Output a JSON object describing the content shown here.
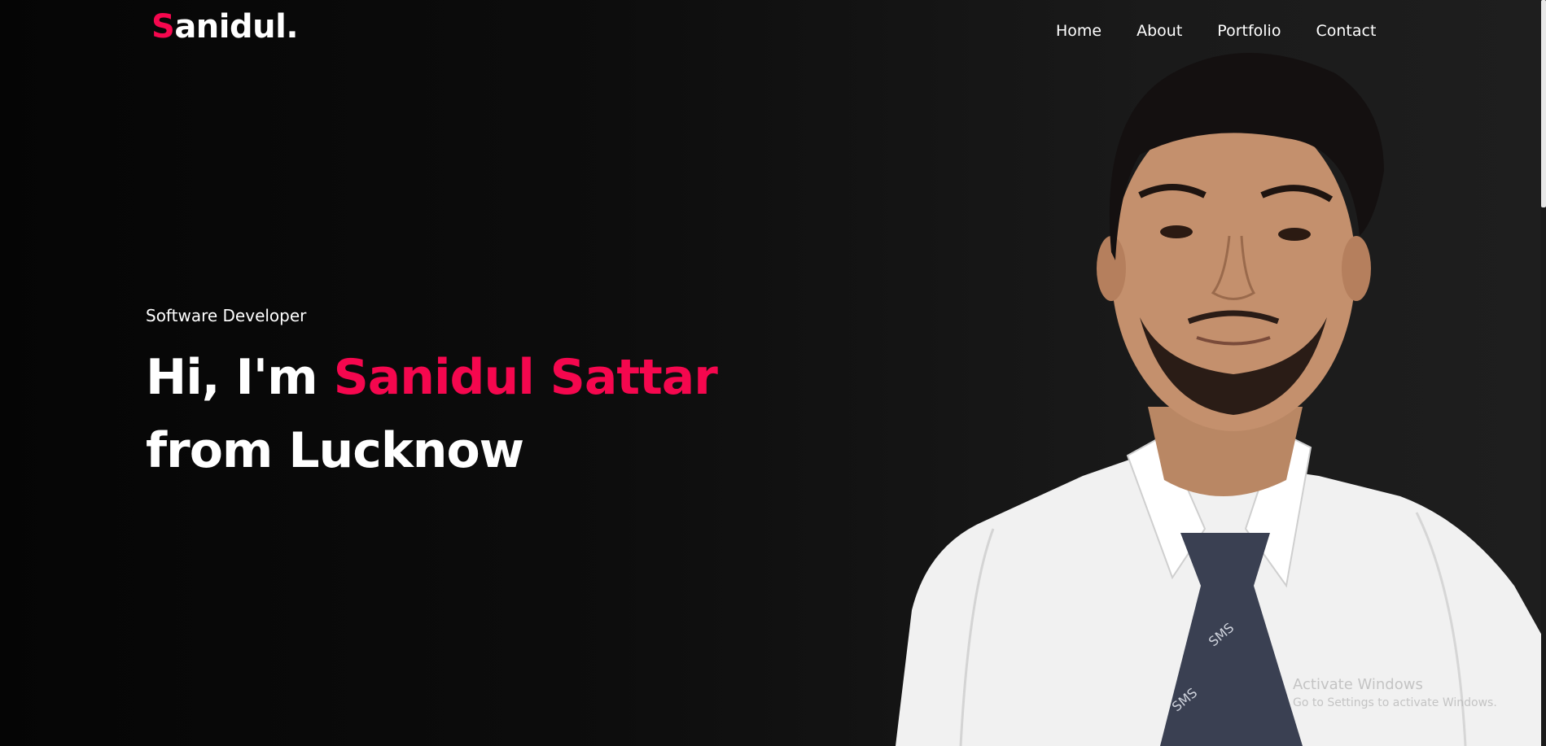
{
  "header": {
    "logo_initial": "S",
    "logo_rest": "anidul.",
    "nav": [
      {
        "label": "Home"
      },
      {
        "label": "About"
      },
      {
        "label": "Portfolio"
      },
      {
        "label": "Contact"
      }
    ]
  },
  "hero": {
    "subtitle": "Software Developer",
    "greeting": "Hi, I'm ",
    "name": "Sanidul Sattar",
    "line2": "from Lucknow"
  },
  "portrait": {
    "tie_text": "SMS"
  },
  "watermark": {
    "title": "Activate Windows",
    "subtitle": "Go to Settings to activate Windows."
  },
  "colors": {
    "accent": "#f5074e",
    "background": "#0d0d0d",
    "text": "#ffffff"
  }
}
